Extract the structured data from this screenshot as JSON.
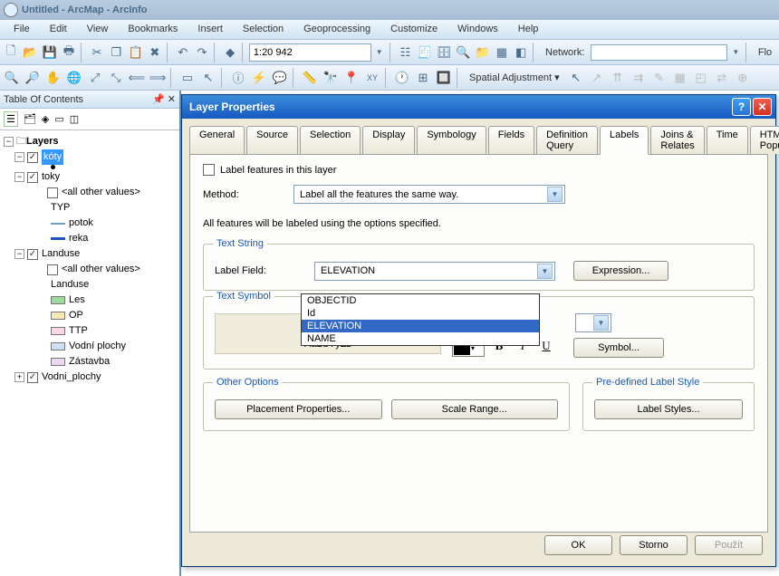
{
  "window": {
    "title": "Untitled - ArcMap - ArcInfo"
  },
  "menu": [
    "File",
    "Edit",
    "View",
    "Bookmarks",
    "Insert",
    "Selection",
    "Geoprocessing",
    "Customize",
    "Windows",
    "Help"
  ],
  "scale": "1:20 942",
  "network_label": "Network:",
  "spatial_adj_label": "Spatial Adjustment",
  "flo_label": "Flo",
  "toc": {
    "title": "Table Of Contents",
    "root": "Layers",
    "koty": "kóty",
    "toky": "toky",
    "toky_all": "<all other values>",
    "toky_typ": "TYP",
    "toky_potok": "potok",
    "toky_reka": "reka",
    "landuse": "Landuse",
    "lu_all": "<all other values>",
    "lu_label": "Landuse",
    "lu_les": "Les",
    "lu_op": "OP",
    "lu_ttp": "TTP",
    "lu_vp": "Vodní plochy",
    "lu_zast": "Zástavba",
    "vodni": "Vodni_plochy"
  },
  "dialog": {
    "title": "Layer Properties",
    "tabs": [
      "General",
      "Source",
      "Selection",
      "Display",
      "Symbology",
      "Fields",
      "Definition Query",
      "Labels",
      "Joins & Relates",
      "Time",
      "HTML Popup"
    ],
    "active_tab": 7,
    "chk_label": "Label features in this layer",
    "method_label": "Method:",
    "method_value": "Label all the features the same way.",
    "desc": "All features will be labeled using the options specified.",
    "text_string_legend": "Text String",
    "label_field_label": "Label Field:",
    "label_field_value": "ELEVATION",
    "label_field_options": [
      "OBJECTID",
      "Id",
      "ELEVATION",
      "NAME"
    ],
    "label_field_selected_index": 2,
    "expression_btn": "Expression...",
    "text_symbol_legend": "Text Symbol",
    "sample_text": "AaBbYyZz",
    "symbol_btn": "Symbol...",
    "other_options_legend": "Other Options",
    "placement_btn": "Placement Properties...",
    "scale_range_btn": "Scale Range...",
    "predef_legend": "Pre-defined Label Style",
    "label_styles_btn": "Label Styles...",
    "ok": "OK",
    "storno": "Storno",
    "pouzit": "Použít"
  }
}
